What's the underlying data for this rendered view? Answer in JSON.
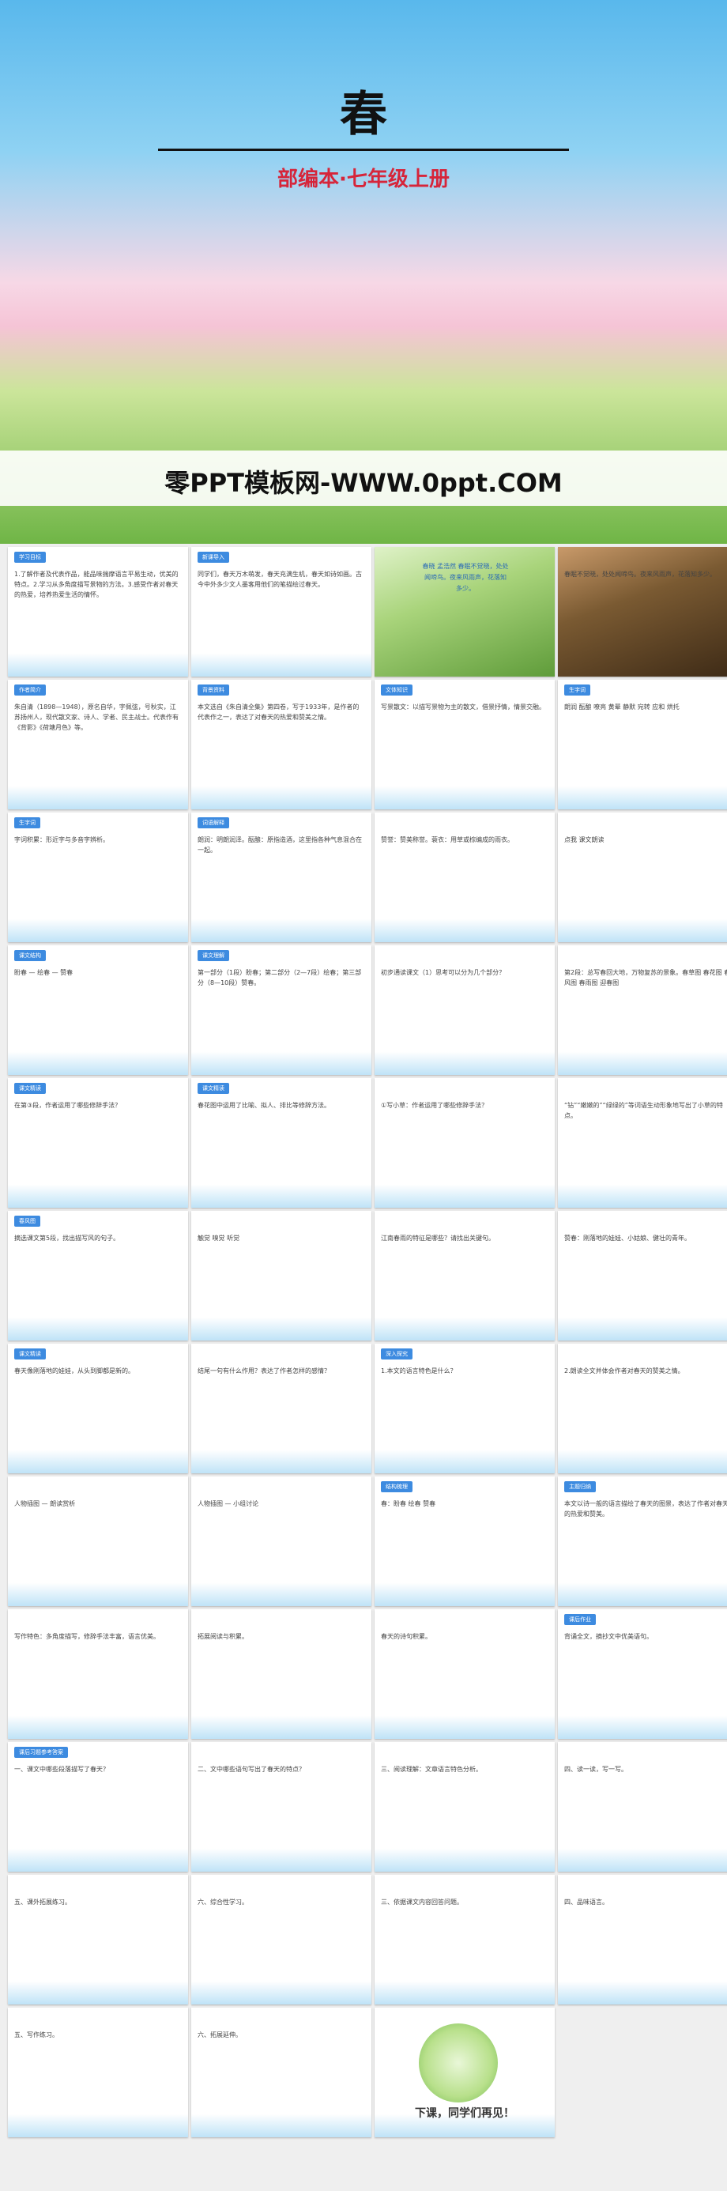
{
  "hero": {
    "title": "春",
    "subtitle": "部编本·七年级上册",
    "site": "零PPT模板网-WWW.0ppt.COM"
  },
  "slides": [
    {
      "tag": "学习目标",
      "text": "1.了解作者及代表作品，能品味揣摩语言平易生动，优美的特点。2.学习从多角度描写景物的方法。3.感受作者对春天的热爱，培养热爱生活的情怀。"
    },
    {
      "tag": "新课导入",
      "text": "同学们，春天万木萌发，春天充满生机，春天如诗如画。古今中外多少文人墨客用他们的笔描绘过春天。"
    },
    {
      "tag": "",
      "text": "春晓 孟浩然 春眠不觉晓，处处闻啼鸟。夜来风雨声，花落知多少。"
    },
    {
      "tag": "",
      "text": "春眠不觉晓，处处闻啼鸟。夜来风雨声，花落知多少。"
    },
    {
      "tag": "作者简介",
      "text": "朱自清（1898—1948），原名自华，字佩弦，号秋实，江苏扬州人，现代散文家、诗人、学者、民主战士。代表作有《背影》《荷塘月色》等。"
    },
    {
      "tag": "背景资料",
      "text": "本文选自《朱自清全集》第四卷，写于1933年，是作者的代表作之一，表达了对春天的热爱和赞美之情。"
    },
    {
      "tag": "文体知识",
      "text": "写景散文：以描写景物为主的散文，借景抒情，情景交融。"
    },
    {
      "tag": "生字词",
      "text": "朗润 酝酿 嘹亮 黄晕 静默 宛转 应和 烘托"
    },
    {
      "tag": "生字词",
      "text": "字词积累：形近字与多音字辨析。"
    },
    {
      "tag": "词语解释",
      "text": "朗润：明朗润泽。酝酿：原指造酒，这里指各种气息混合在一起。"
    },
    {
      "tag": "",
      "text": "赞誉：赞美称誉。蓑衣：用草或棕编成的雨衣。"
    },
    {
      "tag": "",
      "text": "点我 课文朗读"
    },
    {
      "tag": "课文结构",
      "text": "盼春 — 绘春 — 赞春"
    },
    {
      "tag": "课文理解",
      "text": "第一部分（1段）盼春；第二部分（2—7段）绘春；第三部分（8—10段）赞春。"
    },
    {
      "tag": "",
      "text": "初步通读课文（1）思考可以分为几个部分？"
    },
    {
      "tag": "",
      "text": "第2段：总写春回大地，万物复苏的景象。春草图 春花图 春风图 春雨图 迎春图"
    },
    {
      "tag": "课文精读",
      "text": "在第③段，作者运用了哪些修辞手法？"
    },
    {
      "tag": "课文精读",
      "text": "春花图中运用了比喻、拟人、排比等修辞方法。"
    },
    {
      "tag": "",
      "text": "①写小草：作者运用了哪些修辞手法？"
    },
    {
      "tag": "",
      "text": "“钻”“嫩嫩的”“绿绿的”等词语生动形象地写出了小草的特点。"
    },
    {
      "tag": "春风图",
      "text": "摘选课文第5段，找出描写风的句子。"
    },
    {
      "tag": "",
      "text": "触觉 嗅觉 听觉"
    },
    {
      "tag": "",
      "text": "江南春雨的特征是哪些？请找出关键句。"
    },
    {
      "tag": "",
      "text": "赞春：刚落地的娃娃、小姑娘、健壮的青年。"
    },
    {
      "tag": "课文精读",
      "text": "春天像刚落地的娃娃，从头到脚都是新的。"
    },
    {
      "tag": "",
      "text": "结尾一句有什么作用？表达了作者怎样的感情？"
    },
    {
      "tag": "深入探究",
      "text": "1.本文的语言特色是什么？"
    },
    {
      "tag": "",
      "text": "2.朗读全文并体会作者对春天的赞美之情。"
    },
    {
      "tag": "",
      "text": "人物插图 — 朗读赏析"
    },
    {
      "tag": "",
      "text": "人物插图 — 小组讨论"
    },
    {
      "tag": "结构梳理",
      "text": "春：盼春 绘春 赞春"
    },
    {
      "tag": "主题归纳",
      "text": "本文以诗一般的语言描绘了春天的图景，表达了作者对春天的热爱和赞美。"
    },
    {
      "tag": "",
      "text": "写作特色：多角度描写，修辞手法丰富，语言优美。"
    },
    {
      "tag": "",
      "text": "拓展阅读与积累。"
    },
    {
      "tag": "",
      "text": "春天的诗句积累。"
    },
    {
      "tag": "课后作业",
      "text": "背诵全文，摘抄文中优美语句。"
    },
    {
      "tag": "课后习题参考答案",
      "text": "一、课文中哪些段落描写了春天？"
    },
    {
      "tag": "",
      "text": "二、文中哪些语句写出了春天的特点？"
    },
    {
      "tag": "",
      "text": "三、阅读理解：文章语言特色分析。"
    },
    {
      "tag": "",
      "text": "四、读一读，写一写。"
    },
    {
      "tag": "",
      "text": "五、课外拓展练习。"
    },
    {
      "tag": "",
      "text": "六、综合性学习。"
    },
    {
      "tag": "",
      "text": "三、依据课文内容回答问题。"
    },
    {
      "tag": "",
      "text": "四、品味语言。"
    },
    {
      "tag": "",
      "text": "五、写作练习。"
    },
    {
      "tag": "",
      "text": "六、拓展延伸。"
    },
    {
      "tag": "",
      "text": "下课，同学们再见！"
    }
  ]
}
